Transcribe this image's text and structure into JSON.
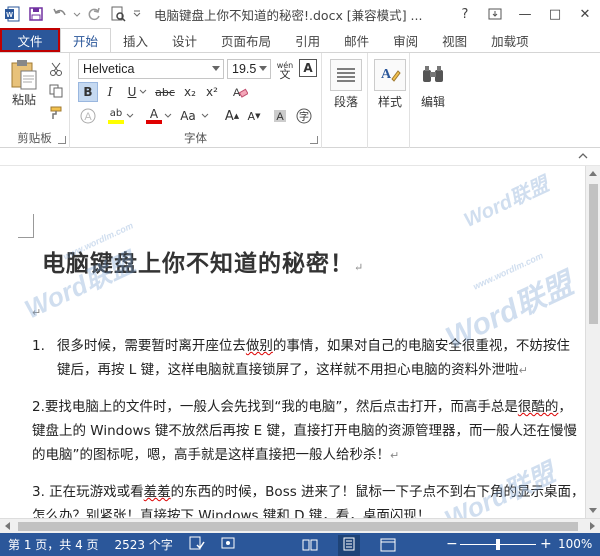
{
  "window": {
    "title": "电脑键盘上你不知道的秘密!.docx [兼容模式] ...",
    "help": "?",
    "minimize": "—",
    "restore": "□",
    "close": "✕"
  },
  "tabs": [
    "文件",
    "开始",
    "插入",
    "设计",
    "页面布局",
    "引用",
    "邮件",
    "审阅",
    "视图",
    "加载项"
  ],
  "ribbon": {
    "clipboard": {
      "paste": "粘贴",
      "label": "剪贴板"
    },
    "font": {
      "family": "Helvetica",
      "size": "19.5",
      "wen": "wén",
      "bold": "B",
      "italic": "I",
      "underline": "U",
      "strike": "abc",
      "subscript": "x₂",
      "superscript": "x²",
      "grow": "A",
      "shrink": "A",
      "case": "Aa",
      "highlight": "ab",
      "color": "A",
      "label": "字体"
    },
    "paragraph": {
      "label": "段落"
    },
    "styles": {
      "label": "样式"
    },
    "editing": {
      "label": "编辑"
    }
  },
  "document": {
    "title": "电脑键盘上你不知道的秘密！",
    "list1_number": "1.",
    "list1_line1_a": "很多时候，需要暂时离开座位去",
    "list1_line1_b": "做别",
    "list1_line1_c": "的事情，如果对自己的电脑安全很重视，不妨按住",
    "list1_line2": "键后，再按 L 键，这样电脑就直接锁屏了，这样就不用担心电脑的资料外泄啦",
    "p2_line1_a": "2.要找电脑上的文件时，一般人会先找到“我的电脑”，然后点击打开，而高手总是",
    "p2_line1_b": "很酷的",
    "p2_line1_c": "，",
    "p2_line2": "键盘上的 Windows 键不放然后再按 E 键，直接打开电脑的资源管理器，而一般人还在慢慢",
    "p2_line3": "的电脑”的图标呢，嗯，高手就是这样直接把一般人给秒杀！",
    "p3_line1_a": "3. 正在玩游戏或看",
    "p3_line1_b": "羞羞",
    "p3_line1_c": "的东西的时候，Boss 进来了！鼠标一下子点不到右下角的显示桌面，",
    "p3_line2": "怎么办？别紧张！直接按下 Windows 键和 D 键，看，桌面闪现！"
  },
  "watermarks": [
    "Word联盟",
    "www.wordlm.com"
  ],
  "status": {
    "page": "第 1 页，共 4 页",
    "words": "2523 个字",
    "zoom_minus": "−",
    "zoom_plus": "+",
    "zoom": "100%",
    "zoom_fraction": 0.5
  },
  "colors": {
    "brand": "#2b579a",
    "file_border": "#c00000",
    "highlight": "#ffff00",
    "font_color": "#e00000"
  }
}
